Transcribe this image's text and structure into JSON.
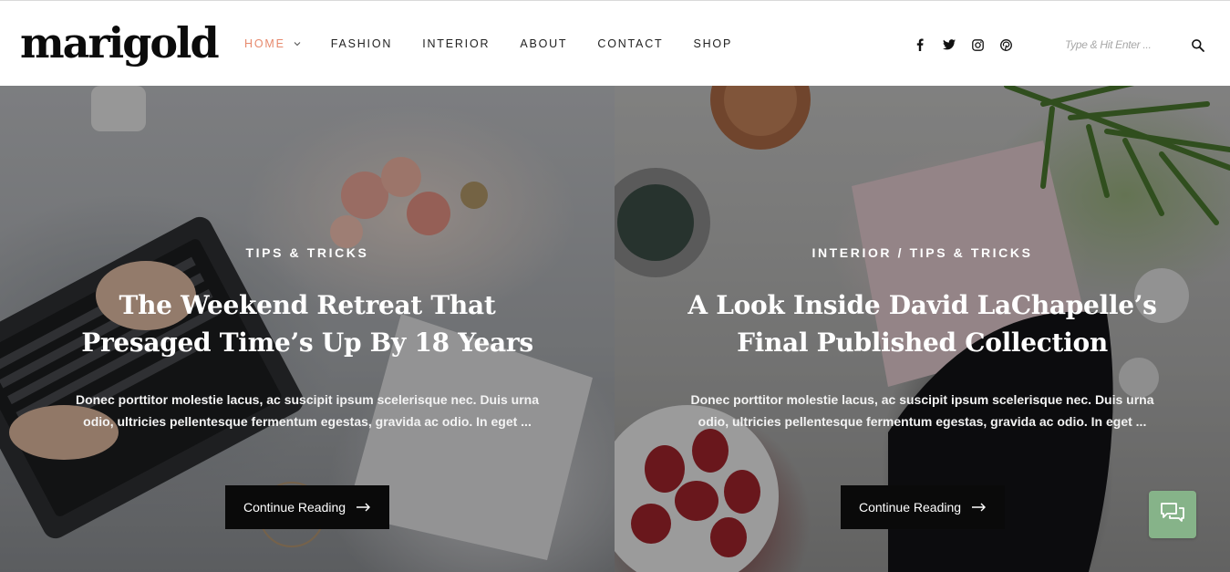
{
  "brand": {
    "logo_text": "marigold"
  },
  "nav": {
    "items": [
      {
        "label": "HOME",
        "active": true,
        "has_dropdown": true
      },
      {
        "label": "FASHION"
      },
      {
        "label": "INTERIOR"
      },
      {
        "label": "ABOUT"
      },
      {
        "label": "CONTACT"
      },
      {
        "label": "SHOP"
      }
    ]
  },
  "social": {
    "icons": [
      "facebook-icon",
      "twitter-icon",
      "instagram-icon",
      "pinterest-icon"
    ]
  },
  "search": {
    "placeholder": "Type & Hit Enter ...",
    "icon": "search-icon"
  },
  "posts": [
    {
      "category": "TIPS & TRICKS",
      "title": "The Weekend Retreat That Presaged Time’s Up By 18 Years",
      "excerpt": "Donec porttitor molestie lacus, ac suscipit ipsum scelerisque nec. Duis urna odio, ultricies pellentesque fermentum egestas, gravida ac odio. In eget ...",
      "cta_label": "Continue Reading"
    },
    {
      "category": "INTERIOR / TIPS & TRICKS",
      "title": "A Look Inside David LaChapelle’s Final Published Collection",
      "excerpt": "Donec porttitor molestie lacus, ac suscipit ipsum scelerisque nec. Duis urna odio, ultricies pellentesque fermentum egestas, gravida ac odio. In eget ...",
      "cta_label": "Continue Reading"
    }
  ],
  "chat": {
    "icon": "chat-icon"
  },
  "colors": {
    "accent": "#e78a6e",
    "chat": "#86b389",
    "button": "#0a0a0a"
  }
}
